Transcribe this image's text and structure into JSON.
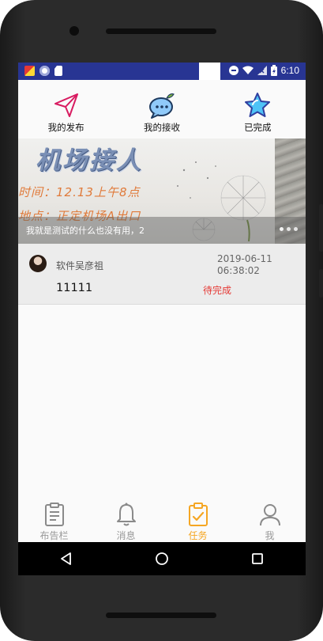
{
  "statusbar": {
    "time": "6:10",
    "left_icons": [
      "app-notification-icon",
      "circle-status-icon",
      "sd-card-icon"
    ],
    "right_icons": [
      "do-not-disturb-icon",
      "wifi-icon",
      "signal-off-icon",
      "battery-charging-icon"
    ]
  },
  "top_tabs": [
    {
      "label": "我的发布",
      "icon": "paper-plane-icon"
    },
    {
      "label": "我的接收",
      "icon": "chat-bubble-icon"
    },
    {
      "label": "已完成",
      "icon": "star-icon"
    }
  ],
  "banner": {
    "title": "机场接人",
    "line1": "时间：12.13上午8点",
    "line2": "地点：正定机场A出口",
    "caption": "我就是测试的什么也没有用，2",
    "dots": 3
  },
  "task": {
    "user": "软件吴彦祖",
    "date": "2019-06-11",
    "time": "06:38:02",
    "title": "11111",
    "status": "待完成",
    "status_color": "#e53935"
  },
  "bottom_nav": [
    {
      "label": "布告栏",
      "icon": "bulletin-board-icon",
      "active": false
    },
    {
      "label": "消息",
      "icon": "bell-icon",
      "active": false
    },
    {
      "label": "任务",
      "icon": "clipboard-check-icon",
      "active": true
    },
    {
      "label": "我",
      "icon": "person-icon",
      "active": false
    }
  ],
  "colors": {
    "statusbar": "#283593",
    "accent_active": "#f5a623",
    "inactive": "#999999"
  }
}
